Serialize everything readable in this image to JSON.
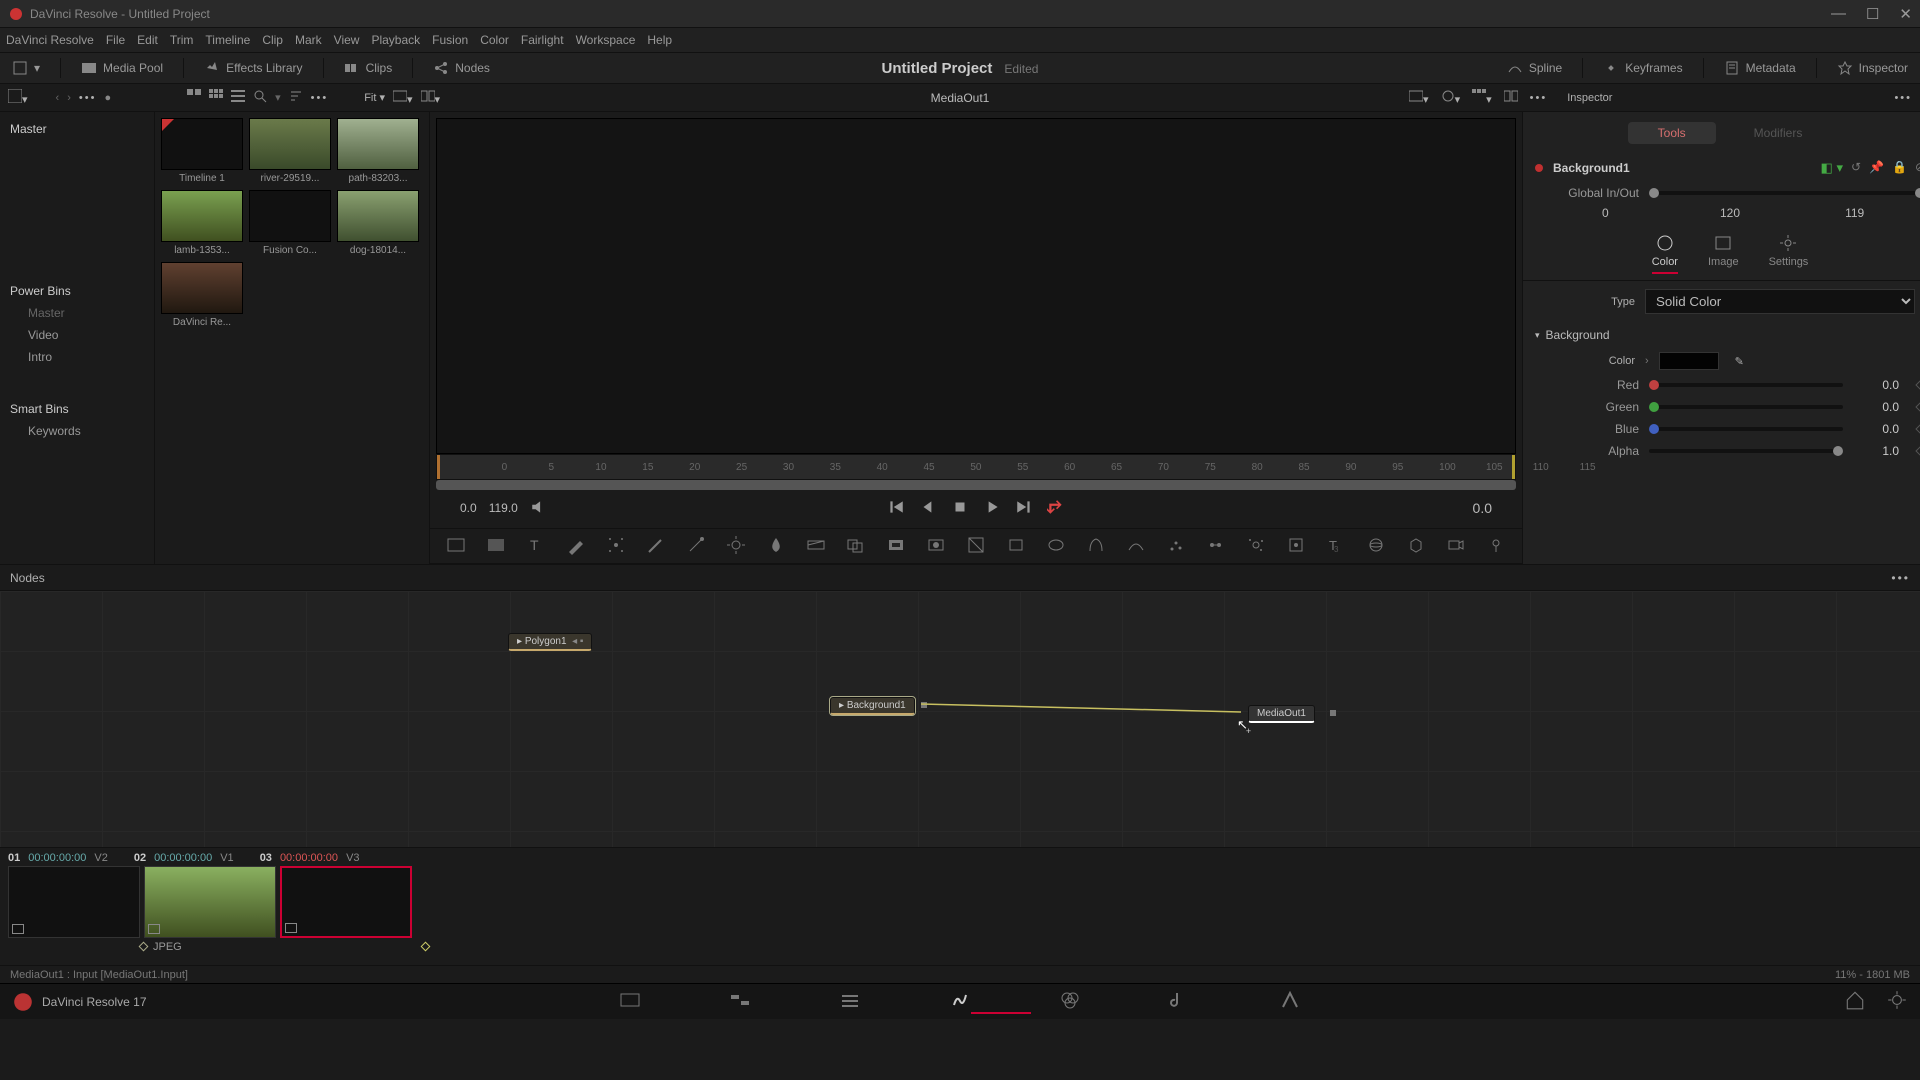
{
  "titlebar": {
    "text": "DaVinci Resolve - Untitled Project"
  },
  "menubar": [
    "DaVinci Resolve",
    "File",
    "Edit",
    "Trim",
    "Timeline",
    "Clip",
    "Mark",
    "View",
    "Playback",
    "Fusion",
    "Color",
    "Fairlight",
    "Workspace",
    "Help"
  ],
  "topToolbar": {
    "mediaPool": "Media Pool",
    "effects": "Effects Library",
    "clips": "Clips",
    "nodes": "Nodes",
    "projectTitle": "Untitled Project",
    "edited": "Edited",
    "spline": "Spline",
    "keyframes": "Keyframes",
    "metadata": "Metadata",
    "inspector": "Inspector"
  },
  "secBar": {
    "fit": "Fit ▾",
    "viewerLabel": "MediaOut1",
    "inspectorHead": "Inspector"
  },
  "bins": {
    "master": "Master",
    "power": "Power Bins",
    "powerItems": [
      "Master",
      "Video",
      "Intro"
    ],
    "smart": "Smart Bins",
    "smartItems": [
      "Keywords"
    ]
  },
  "thumbs": [
    {
      "label": "Timeline 1",
      "cls": "tl"
    },
    {
      "label": "river-29519...",
      "cls": "nature1"
    },
    {
      "label": "path-83203...",
      "cls": "nature2"
    },
    {
      "label": "lamb-1353...",
      "cls": "nature3"
    },
    {
      "label": "Fusion Co...",
      "cls": "blackbox"
    },
    {
      "label": "dog-18014...",
      "cls": "nature4"
    },
    {
      "label": "DaVinci Re...",
      "cls": "track"
    }
  ],
  "ruler": [
    "0",
    "5",
    "10",
    "15",
    "20",
    "25",
    "30",
    "35",
    "40",
    "45",
    "50",
    "55",
    "60",
    "65",
    "70",
    "75",
    "80",
    "85",
    "90",
    "95",
    "100",
    "105",
    "110",
    "115"
  ],
  "transport": {
    "leftA": "0.0",
    "leftB": "119.0",
    "right": "0.0"
  },
  "nodesPanel": {
    "title": "Nodes",
    "polygon": "Polygon1",
    "bg": "Background1",
    "out": "MediaOut1"
  },
  "inspector": {
    "tabTools": "Tools",
    "tabModifiers": "Modifiers",
    "nodeName": "Background1",
    "globalLabel": "Global In/Out",
    "range": {
      "in": "0",
      "mid": "120",
      "out": "119"
    },
    "cats": {
      "color": "Color",
      "image": "Image",
      "settings": "Settings"
    },
    "typeLabel": "Type",
    "typeValue": "Solid Color",
    "sectionBg": "Background",
    "colorLabel": "Color",
    "channels": [
      {
        "name": "Red",
        "v": "0.0",
        "col": "#c04040"
      },
      {
        "name": "Green",
        "v": "0.0",
        "col": "#40a040"
      },
      {
        "name": "Blue",
        "v": "0.0",
        "col": "#4060c0"
      },
      {
        "name": "Alpha",
        "v": "1.0",
        "col": "#888"
      }
    ]
  },
  "clipStrip": {
    "items": [
      {
        "idx": "01",
        "tc": "00:00:00:00",
        "track": "V2"
      },
      {
        "idx": "02",
        "tc": "00:00:00:00",
        "track": "V1"
      },
      {
        "idx": "03",
        "tc": "00:00:00:00",
        "track": "V3"
      }
    ],
    "format": "JPEG"
  },
  "status": {
    "left": "MediaOut1 : Input   [MediaOut1.Input]",
    "right": "11% - 1801 MB"
  },
  "footer": {
    "app": "DaVinci Resolve 17"
  }
}
